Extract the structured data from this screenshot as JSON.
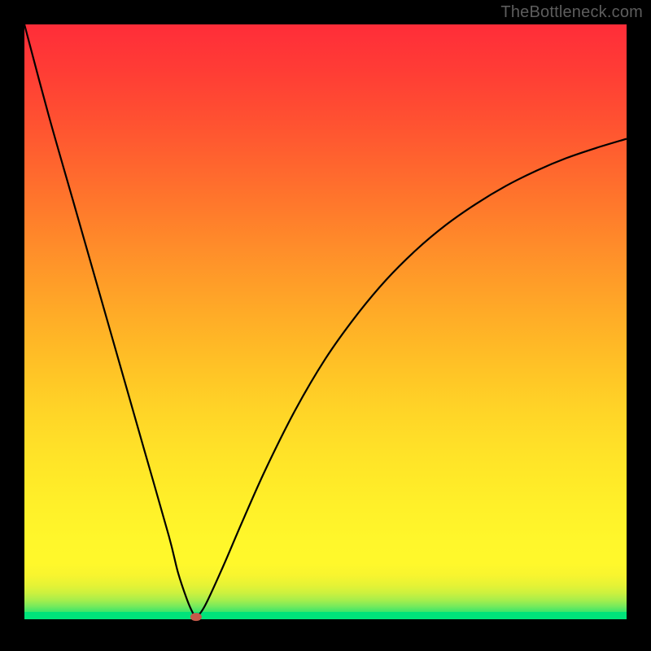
{
  "watermark": "TheBottleneck.com",
  "colors": {
    "curve": "#000000",
    "marker": "#c45a4a",
    "frame": "#000000"
  },
  "chart_data": {
    "type": "line",
    "title": "",
    "xlabel": "",
    "ylabel": "",
    "xlim": [
      0,
      100
    ],
    "ylim": [
      0,
      100
    ],
    "marker": {
      "x": 28.5,
      "y": 1.6
    },
    "series": [
      {
        "name": "bottleneck-curve",
        "x": [
          0,
          4,
          8,
          12,
          16,
          20,
          24,
          25.5,
          27,
          28,
          28.5,
          30,
          33,
          36,
          40,
          45,
          50,
          55,
          60,
          65,
          70,
          75,
          80,
          85,
          90,
          95,
          100
        ],
        "y": [
          100,
          85,
          71,
          57,
          43,
          29,
          15,
          9,
          4.5,
          2.2,
          1.6,
          3.5,
          10,
          17,
          26,
          36,
          44.5,
          51.5,
          57.5,
          62.5,
          66.7,
          70.2,
          73.2,
          75.7,
          77.8,
          79.5,
          81
        ]
      }
    ],
    "gradient_stops_percent_from_bottom": {
      "black_base": 1.2,
      "green": 2.4,
      "yellow_start": 10,
      "red_top": 100
    }
  }
}
